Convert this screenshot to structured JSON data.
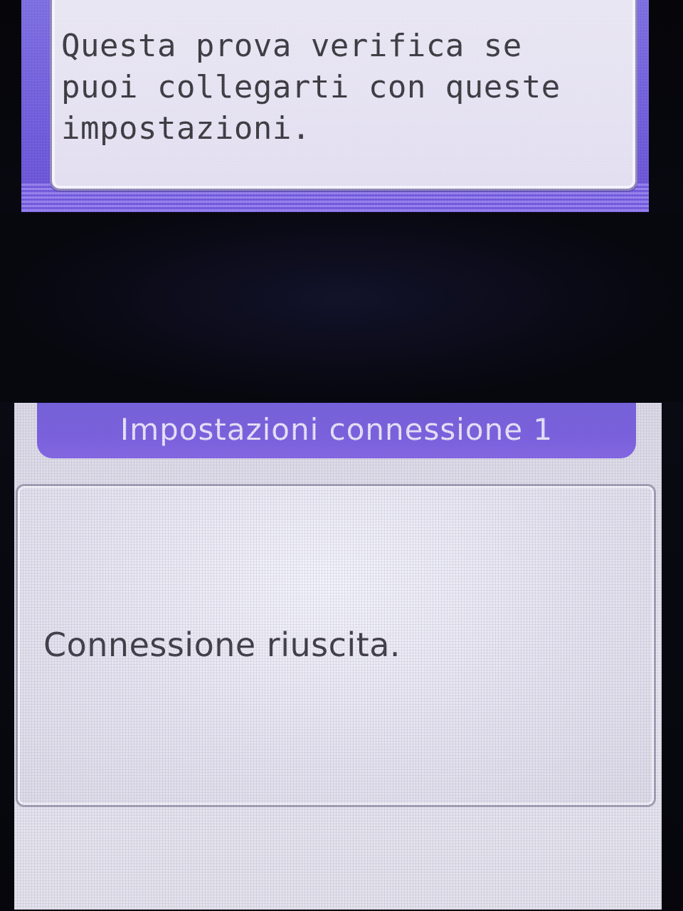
{
  "top_screen": {
    "message": "Questa prova verifica se\npuoi collegarti con queste\nimpostazioni."
  },
  "bottom_screen": {
    "title": "Impostazioni connessione 1",
    "status": "Connessione riuscita."
  },
  "colors": {
    "accent_purple": "#7560dc",
    "panel_background": "#e6e4ef",
    "text_dark": "#3e3d45",
    "title_text": "#e8e4fb"
  }
}
